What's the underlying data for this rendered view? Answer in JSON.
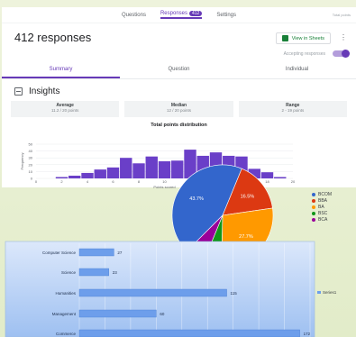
{
  "forms": {
    "tabs": [
      {
        "label": "Questions"
      },
      {
        "label": "Responses",
        "badge": "412",
        "active": true
      },
      {
        "label": "Settings"
      }
    ],
    "top_right": "Total points",
    "title": "412 responses",
    "view_in_sheets": "View in Sheets",
    "accepting_label": "Accepting responses",
    "subtabs": [
      "Summary",
      "Question",
      "Individual"
    ],
    "insights_label": "Insights",
    "stats": [
      {
        "label": "Average",
        "value": "11.2 / 20 points"
      },
      {
        "label": "Median",
        "value": "12 / 20 points"
      },
      {
        "label": "Range",
        "value": "2 - 19 points"
      }
    ]
  },
  "colors": {
    "accent": "#673ab7",
    "sheets_green": "#188038",
    "hist_bar": "#6a3fc8",
    "bar_fill": "#6d9eeb"
  },
  "chart_data": [
    {
      "type": "bar",
      "title": "Total points distribution",
      "xlabel": "Points scored",
      "ylabel": "Frequency",
      "ylim": [
        0,
        50
      ],
      "yticks": [
        0,
        10,
        20,
        30,
        40,
        50
      ],
      "xticks": [
        0,
        2,
        4,
        6,
        8,
        10,
        12,
        14,
        16,
        18,
        20
      ],
      "categories": [
        2,
        3,
        4,
        5,
        6,
        7,
        8,
        9,
        10,
        11,
        12,
        13,
        14,
        15,
        16,
        17,
        18,
        19
      ],
      "values": [
        2,
        4,
        8,
        13,
        16,
        30,
        22,
        32,
        25,
        26,
        42,
        33,
        38,
        33,
        32,
        14,
        9,
        2
      ]
    },
    {
      "type": "pie",
      "slices": [
        {
          "label": "BCOM",
          "value": 43.7,
          "display": "43.7%",
          "color": "#3366cc"
        },
        {
          "label": "BBA",
          "value": 16.5,
          "display": "16.5%",
          "color": "#dc3912"
        },
        {
          "label": "BA",
          "value": 27.7,
          "display": "27.7%",
          "color": "#ff9900"
        },
        {
          "label": "BSC",
          "value": 5.8,
          "display": "",
          "color": "#109618"
        },
        {
          "label": "BCA",
          "value": 6.3,
          "display": "",
          "color": "#990099"
        }
      ]
    },
    {
      "type": "bar",
      "orientation": "horizontal",
      "categories": [
        "Computer Science",
        "Science",
        "Humanities",
        "Management",
        "Commerce"
      ],
      "series": [
        {
          "name": "Series1",
          "values": [
            27,
            23,
            115,
            60,
            172
          ]
        }
      ],
      "xlim": [
        0,
        180
      ]
    }
  ]
}
